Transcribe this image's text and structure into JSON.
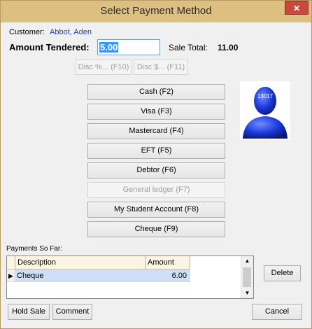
{
  "window": {
    "title": "Select Payment Method",
    "close_glyph": "✕"
  },
  "customer": {
    "label": "Customer:",
    "name": "Abbot, Aden"
  },
  "tender": {
    "label": "Amount Tendered:",
    "value": "5.00",
    "sale_total_label": "Sale Total:",
    "sale_total_value": "11.00"
  },
  "discount": {
    "percent_label": "Disc %... (F10)",
    "amount_label": "Disc $... (F11)"
  },
  "payment_methods": [
    {
      "label": "Cash (F2)",
      "enabled": true
    },
    {
      "label": "Visa (F3)",
      "enabled": true
    },
    {
      "label": "Mastercard (F4)",
      "enabled": true
    },
    {
      "label": "EFT (F5)",
      "enabled": true
    },
    {
      "label": "Debtor (F6)",
      "enabled": true
    },
    {
      "label": "General ledger (F7)",
      "enabled": false
    },
    {
      "label": "My Student Account (F8)",
      "enabled": true
    },
    {
      "label": "Cheque (F9)",
      "enabled": true
    }
  ],
  "student_photo": {
    "id_text": "13017"
  },
  "payments": {
    "section_label": "Payments So Far:",
    "columns": [
      "Description",
      "Amount"
    ],
    "rows": [
      {
        "description": "Cheque",
        "amount": "6.00"
      }
    ],
    "delete_label": "Delete"
  },
  "footer": {
    "hold_label": "Hold Sale",
    "comment_label": "Comment",
    "cancel_label": "Cancel"
  },
  "colors": {
    "accent_link": "#1f3fbf",
    "titlebar": "#ddbf82",
    "selection": "#3399ff",
    "row_highlight": "#cde0f7"
  }
}
